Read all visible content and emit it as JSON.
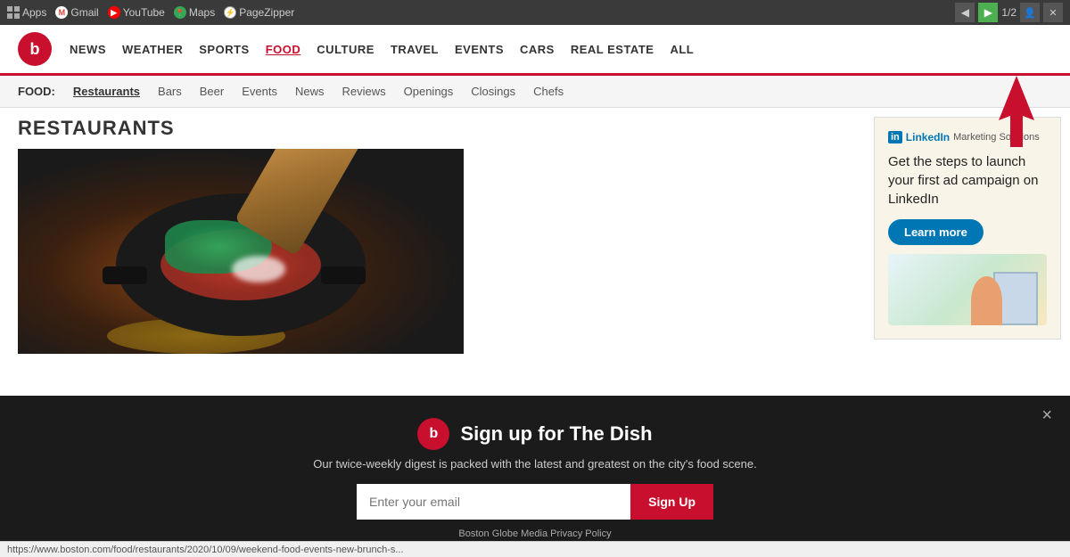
{
  "browser": {
    "bar_items": [
      {
        "name": "Apps",
        "type": "apps",
        "label": "Apps"
      },
      {
        "name": "Gmail",
        "type": "gmail",
        "label": "Gmail"
      },
      {
        "name": "YouTube",
        "type": "youtube",
        "label": "YouTube"
      },
      {
        "name": "Maps",
        "type": "maps",
        "label": "Maps"
      },
      {
        "name": "PageZipper",
        "type": "pagezipper",
        "label": "PageZipper"
      }
    ],
    "page_count": "1/2"
  },
  "site": {
    "logo_letter": "b",
    "nav_items": [
      {
        "id": "news",
        "label": "NEWS"
      },
      {
        "id": "weather",
        "label": "WEATHER"
      },
      {
        "id": "sports",
        "label": "SPORTS"
      },
      {
        "id": "food",
        "label": "FOOD",
        "active": true
      },
      {
        "id": "culture",
        "label": "CULTURE"
      },
      {
        "id": "travel",
        "label": "TRAVEL"
      },
      {
        "id": "events",
        "label": "EVENTS"
      },
      {
        "id": "cars",
        "label": "CARS"
      },
      {
        "id": "realestate",
        "label": "REAL ESTATE"
      },
      {
        "id": "all",
        "label": "ALL"
      }
    ],
    "sub_nav_label": "FOOD:",
    "sub_nav_items": [
      {
        "id": "restaurants",
        "label": "Restaurants",
        "active": true
      },
      {
        "id": "bars",
        "label": "Bars"
      },
      {
        "id": "beer",
        "label": "Beer"
      },
      {
        "id": "events",
        "label": "Events"
      },
      {
        "id": "news",
        "label": "News"
      },
      {
        "id": "reviews",
        "label": "Reviews"
      },
      {
        "id": "openings",
        "label": "Openings"
      },
      {
        "id": "closings",
        "label": "Closings"
      },
      {
        "id": "chefs",
        "label": "Chefs"
      }
    ],
    "section_title": "RESTAURANTS"
  },
  "ad": {
    "linkedin_in": "in",
    "linkedin_brand": "LinkedIn",
    "linkedin_sub": "Marketing Solutions",
    "copy": "Get the steps to launch your first ad campaign on LinkedIn",
    "cta": "Learn more"
  },
  "newsletter": {
    "logo_letter": "b",
    "title": "Sign up for The Dish",
    "description": "Our twice-weekly digest is packed with the latest and greatest on the city's food scene.",
    "email_placeholder": "Enter your email",
    "cta": "Sign Up",
    "privacy_text": "Boston Globe Media Privacy Policy",
    "close_label": "×"
  },
  "status_bar": {
    "url": "https://www.boston.com/food/restaurants/2020/10/09/weekend-food-events-new-brunch-s..."
  }
}
